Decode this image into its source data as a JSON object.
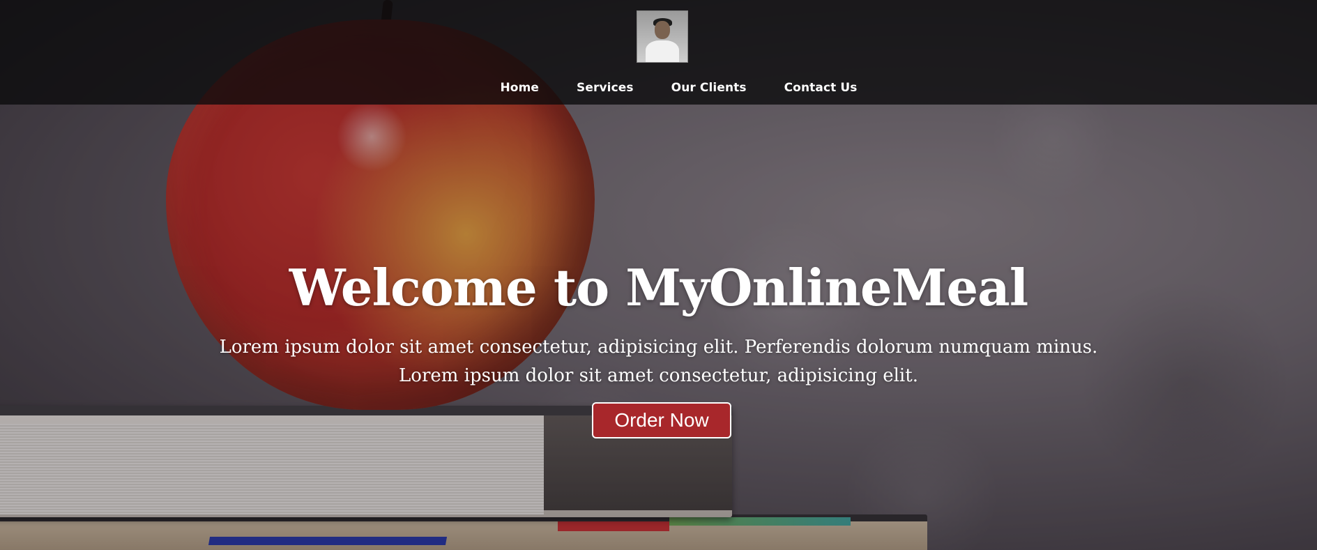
{
  "header": {
    "logo_alt": "profile photo logo",
    "nav": [
      "Home",
      "Services",
      "Our Clients",
      "Contact Us"
    ]
  },
  "hero": {
    "headline": "Welcome to MyOnlineMeal",
    "sub_line1": "Lorem ipsum dolor sit amet consectetur, adipisicing elit. Perferendis dolorum numquam minus.",
    "sub_line2": "Lorem ipsum dolor sit amet consectetur, adipisicing elit.",
    "cta_label": "Order Now"
  },
  "colors": {
    "cta_background": "#a8272b",
    "header_background": "#0a0a0c",
    "text": "#ffffff"
  }
}
